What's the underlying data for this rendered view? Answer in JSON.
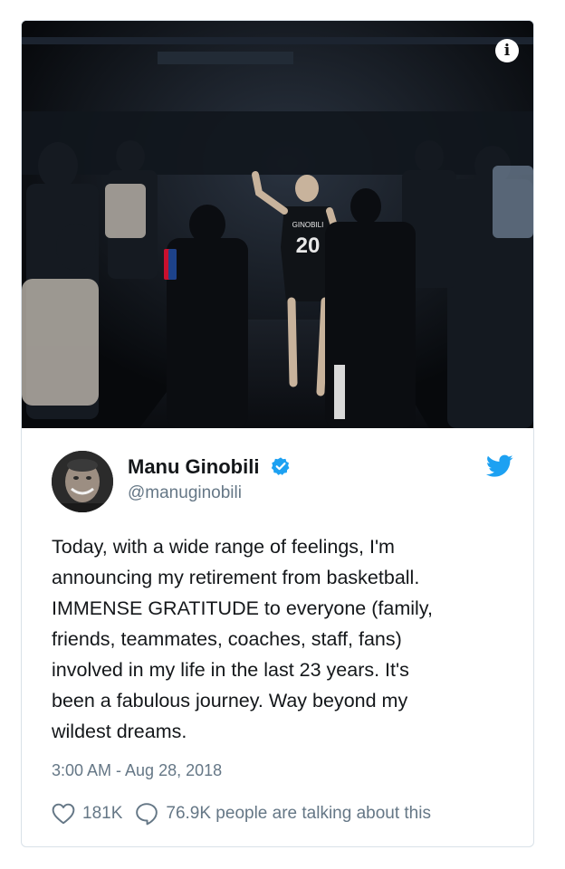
{
  "tweet": {
    "author_name": "Manu Ginobili",
    "handle": "@manuginobili",
    "text": "Today, with a wide range of feelings, I'm\nannouncing my retirement from basketball.\nIMMENSE GRATITUDE to everyone (family,\nfriends, teammates, coaches, staff, fans)\ninvolved in my life in the last 23 years. It's\nbeen a fabulous journey. Way beyond my\nwildest dreams.",
    "timestamp": "3:00 AM - Aug 28, 2018",
    "likes": "181K",
    "conversation": "76.9K people are talking about this"
  },
  "media": {
    "jersey_name": "GINOBILI",
    "jersey_number": "20",
    "info_icon": "i"
  },
  "icons": {
    "info": "info-icon",
    "verified": "verified-badge-icon",
    "twitter": "twitter-bird-icon",
    "like": "heart-icon",
    "comment": "speech-bubble-icon"
  },
  "colors": {
    "twitter_blue": "#1da1f2",
    "text_primary": "#14171a",
    "text_secondary": "#657786",
    "card_border": "#d9e1e8"
  }
}
